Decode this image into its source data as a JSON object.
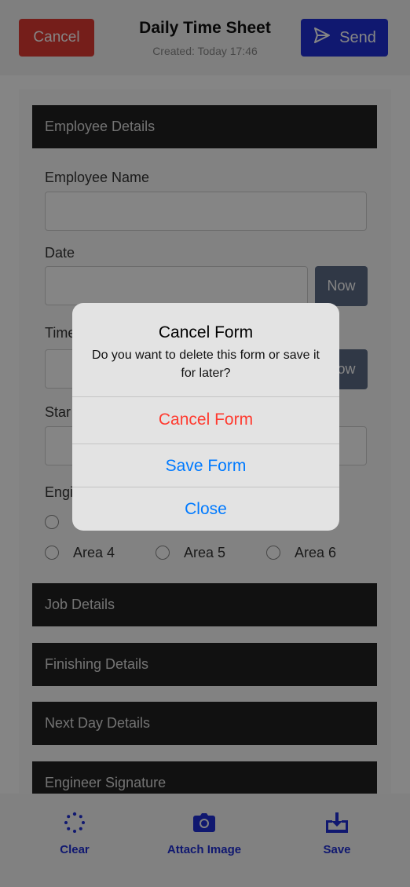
{
  "header": {
    "cancel_label": "Cancel",
    "title": "Daily Time Sheet",
    "subtitle": "Created: Today 17:46",
    "send_label": "Send"
  },
  "sections": {
    "employee_details": "Employee Details",
    "job_details": "Job Details",
    "finishing_details": "Finishing Details",
    "next_day_details": "Next Day Details",
    "engineer_signature": "Engineer Signature"
  },
  "fields": {
    "employee_name_label": "Employee Name",
    "date_label": "Date",
    "now_label": "Now",
    "time_label_partial": "Time",
    "start_label_partial": "Star",
    "engineer_label_partial": "Engi"
  },
  "areas": [
    "Area 4",
    "Area 5",
    "Area 6"
  ],
  "dialog": {
    "title": "Cancel Form",
    "message": "Do you want to delete this form or save it for later?",
    "cancel_form": "Cancel Form",
    "save_form": "Save Form",
    "close": "Close"
  },
  "toolbar": {
    "clear": "Clear",
    "attach_image": "Attach Image",
    "save": "Save"
  },
  "colors": {
    "cancel_red": "#e03a33",
    "brand_blue": "#1f2fd6",
    "dialog_destructive": "#ff3b30",
    "dialog_action": "#007aff"
  },
  "icons": {
    "send": "send-icon",
    "clear": "spinner-icon",
    "attach": "camera-icon",
    "save": "download-tray-icon"
  }
}
